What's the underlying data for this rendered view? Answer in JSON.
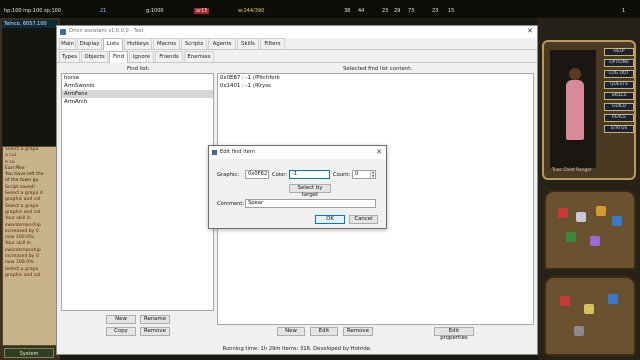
{
  "game": {
    "hud": {
      "vitals": "hp:100  mp:100  sp:100",
      "stat_a": "21",
      "gold": "g:1000",
      "tag": "ar15",
      "weight": "w:244/390",
      "counters": [
        "38",
        "44",
        "23",
        "29",
        "73",
        "23",
        "15"
      ],
      "bar_end": "1"
    },
    "left_window_title": "Telnco, 6057,100",
    "journal_lines": [
      "Select a grapa",
      "a cui",
      "e cu",
      "Earl Pike",
      "You have left the",
      "of the town gu",
      "Script saved!",
      "Select a grapa d",
      "graphic and col",
      "Select a grapa",
      "graphic and col",
      "Your skill in",
      "swordsmanship",
      "increased by 0",
      "now 100.0%.",
      "Your skill in",
      "swordsmanship",
      "increased by 0",
      "now 100.0%.",
      "Select a grapa",
      "graphic and col"
    ],
    "system_label": "System",
    "paperdoll_buttons": [
      "HELP",
      "OPTIONS",
      "LOG OUT",
      "QUESTS",
      "SKILLS",
      "GUILD",
      "PEACE",
      "STATUS"
    ],
    "paperdoll_name": "Tuxo Chief Ranger"
  },
  "app": {
    "title": "Orion assistant v1.0.0.0 - Test",
    "main_tabs": [
      "Main",
      "Display",
      "Lists",
      "Hotkeys",
      "Macros",
      "Scripts",
      "Agents",
      "Skills",
      "Filters"
    ],
    "active_main_tab": "Lists",
    "sub_tabs": [
      "Types",
      "Objects",
      "Find",
      "Ignore",
      "Friends",
      "Enemies"
    ],
    "active_sub_tab": "Find",
    "find_list": {
      "label": "Find list:",
      "items": [
        "horse",
        "ArmSwords",
        "ArmFens",
        "ArmArch"
      ],
      "selected": "ArmFens",
      "buttons": {
        "new": "New",
        "rename": "Rename",
        "copy": "Copy",
        "remove": "Remove"
      }
    },
    "content": {
      "label": "Selected find list content:",
      "items": [
        "0x0E87 : -1 //Pitchfork",
        "0x1401 : -1 //Kryss"
      ],
      "buttons": {
        "new": "New",
        "edit": "Edit",
        "remove": "Remove",
        "properties": "Edit properties"
      }
    },
    "status": "Running time: 1h 29m  Items: 316.  Developed by Hotride."
  },
  "modal": {
    "title": "Edit find item",
    "graphic_label": "Graphic:",
    "graphic_value": "0x0F62",
    "color_label": "Color:",
    "color_value": "-1",
    "count_label": "Count:",
    "count_value": "0",
    "select_target": "Select by target",
    "comment_label": "Comment:",
    "comment_value": "Spear",
    "ok": "OK",
    "cancel": "Cancel"
  },
  "colors": {
    "accent": "#0078d7",
    "selection": "#d6d6d6",
    "window_bg": "#f0f0f0",
    "journal_text": "#5a1a0a"
  }
}
